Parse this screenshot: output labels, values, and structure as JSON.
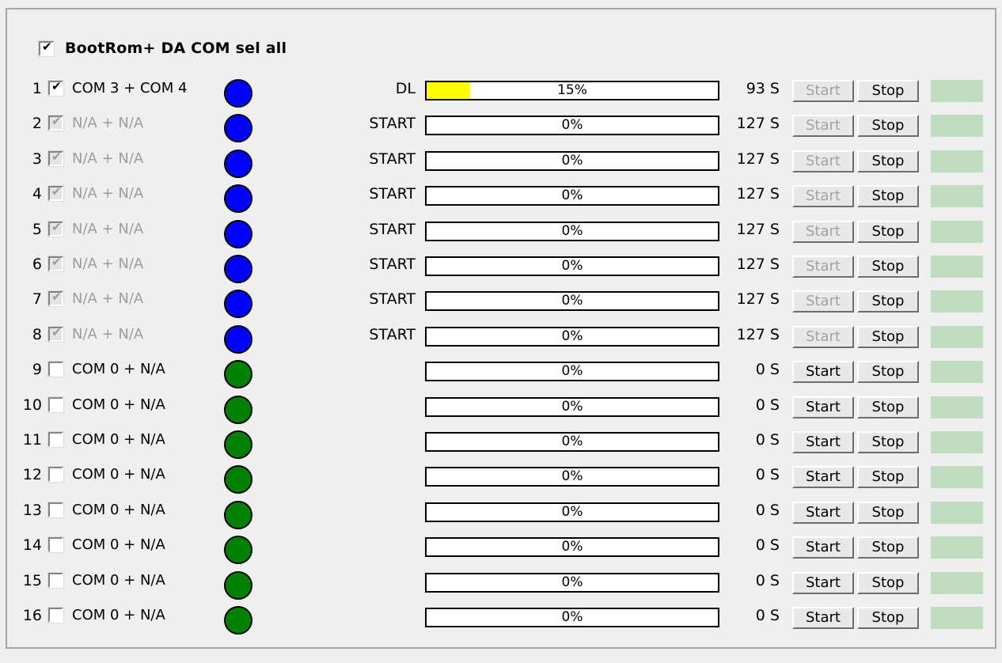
{
  "window": {
    "background_color": "#efefef",
    "frame_border_color": "#a6a6a6"
  },
  "header": {
    "checkbox_checked": true,
    "checkbox_enabled": true,
    "label": "BootRom+ DA COM sel all",
    "tick_glyph": "✔"
  },
  "colors": {
    "led_active": "#0000ff",
    "led_idle": "#008000",
    "progress_fill": "#ffff00",
    "status_box": "#bfdcc0",
    "disabled_text": "#9d9d9d",
    "text": "#000000"
  },
  "buttons": {
    "start_label": "Start",
    "stop_label": "Stop"
  },
  "rows": [
    {
      "index": "1",
      "checked": true,
      "enabled": true,
      "port_label": "COM 3 + COM 4",
      "led": "blue",
      "stage": "DL",
      "percent_text": "15%",
      "percent_value": 15,
      "seconds": "93 S",
      "start_enabled": false,
      "stop_enabled": true
    },
    {
      "index": "2",
      "checked": true,
      "enabled": false,
      "port_label": "N/A + N/A",
      "led": "blue",
      "stage": "START",
      "percent_text": "0%",
      "percent_value": 0,
      "seconds": "127 S",
      "start_enabled": false,
      "stop_enabled": true
    },
    {
      "index": "3",
      "checked": true,
      "enabled": false,
      "port_label": "N/A + N/A",
      "led": "blue",
      "stage": "START",
      "percent_text": "0%",
      "percent_value": 0,
      "seconds": "127 S",
      "start_enabled": false,
      "stop_enabled": true
    },
    {
      "index": "4",
      "checked": true,
      "enabled": false,
      "port_label": "N/A + N/A",
      "led": "blue",
      "stage": "START",
      "percent_text": "0%",
      "percent_value": 0,
      "seconds": "127 S",
      "start_enabled": false,
      "stop_enabled": true
    },
    {
      "index": "5",
      "checked": true,
      "enabled": false,
      "port_label": "N/A + N/A",
      "led": "blue",
      "stage": "START",
      "percent_text": "0%",
      "percent_value": 0,
      "seconds": "127 S",
      "start_enabled": false,
      "stop_enabled": true
    },
    {
      "index": "6",
      "checked": true,
      "enabled": false,
      "port_label": "N/A + N/A",
      "led": "blue",
      "stage": "START",
      "percent_text": "0%",
      "percent_value": 0,
      "seconds": "127 S",
      "start_enabled": false,
      "stop_enabled": true
    },
    {
      "index": "7",
      "checked": true,
      "enabled": false,
      "port_label": "N/A + N/A",
      "led": "blue",
      "stage": "START",
      "percent_text": "0%",
      "percent_value": 0,
      "seconds": "127 S",
      "start_enabled": false,
      "stop_enabled": true
    },
    {
      "index": "8",
      "checked": true,
      "enabled": false,
      "port_label": "N/A + N/A",
      "led": "blue",
      "stage": "START",
      "percent_text": "0%",
      "percent_value": 0,
      "seconds": "127 S",
      "start_enabled": false,
      "stop_enabled": true
    },
    {
      "index": "9",
      "checked": false,
      "enabled": true,
      "port_label": "COM 0 + N/A",
      "led": "green",
      "stage": "",
      "percent_text": "0%",
      "percent_value": 0,
      "seconds": "0 S",
      "start_enabled": true,
      "stop_enabled": true
    },
    {
      "index": "10",
      "checked": false,
      "enabled": true,
      "port_label": "COM 0 + N/A",
      "led": "green",
      "stage": "",
      "percent_text": "0%",
      "percent_value": 0,
      "seconds": "0 S",
      "start_enabled": true,
      "stop_enabled": true
    },
    {
      "index": "11",
      "checked": false,
      "enabled": true,
      "port_label": "COM 0 + N/A",
      "led": "green",
      "stage": "",
      "percent_text": "0%",
      "percent_value": 0,
      "seconds": "0 S",
      "start_enabled": true,
      "stop_enabled": true
    },
    {
      "index": "12",
      "checked": false,
      "enabled": true,
      "port_label": "COM 0 + N/A",
      "led": "green",
      "stage": "",
      "percent_text": "0%",
      "percent_value": 0,
      "seconds": "0 S",
      "start_enabled": true,
      "stop_enabled": true
    },
    {
      "index": "13",
      "checked": false,
      "enabled": true,
      "port_label": "COM 0 + N/A",
      "led": "green",
      "stage": "",
      "percent_text": "0%",
      "percent_value": 0,
      "seconds": "0 S",
      "start_enabled": true,
      "stop_enabled": true
    },
    {
      "index": "14",
      "checked": false,
      "enabled": true,
      "port_label": "COM 0 + N/A",
      "led": "green",
      "stage": "",
      "percent_text": "0%",
      "percent_value": 0,
      "seconds": "0 S",
      "start_enabled": true,
      "stop_enabled": true
    },
    {
      "index": "15",
      "checked": false,
      "enabled": true,
      "port_label": "COM 0 + N/A",
      "led": "green",
      "stage": "",
      "percent_text": "0%",
      "percent_value": 0,
      "seconds": "0 S",
      "start_enabled": true,
      "stop_enabled": true
    },
    {
      "index": "16",
      "checked": false,
      "enabled": true,
      "port_label": "COM 0 + N/A",
      "led": "green",
      "stage": "",
      "percent_text": "0%",
      "percent_value": 0,
      "seconds": "0 S",
      "start_enabled": true,
      "stop_enabled": true
    }
  ]
}
